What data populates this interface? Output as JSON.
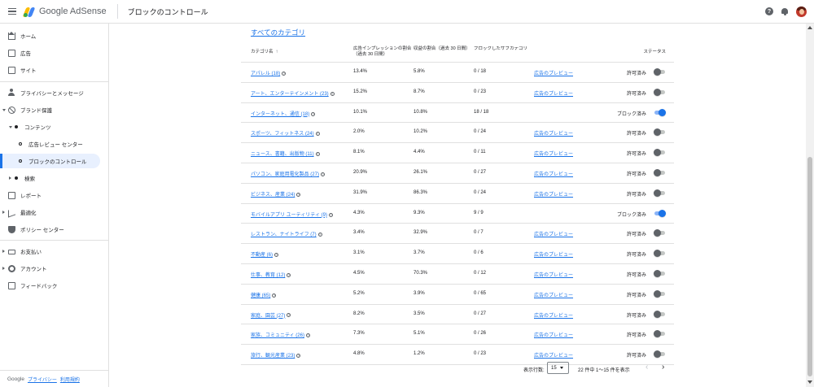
{
  "header": {
    "app_name": "Google AdSense",
    "page_title": "ブロックのコントロール"
  },
  "sidebar": {
    "items": [
      {
        "label": "ホーム"
      },
      {
        "label": "広告"
      },
      {
        "label": "サイト"
      },
      {
        "label": "プライバシーとメッセージ"
      },
      {
        "label": "ブランド保護"
      },
      {
        "label": "コンテンツ"
      },
      {
        "label": "広告レビュー センター"
      },
      {
        "label": "ブロックのコントロール"
      },
      {
        "label": "検索"
      },
      {
        "label": "レポート"
      },
      {
        "label": "最適化"
      },
      {
        "label": "ポリシー センター"
      },
      {
        "label": "お支払い"
      },
      {
        "label": "アカウント"
      },
      {
        "label": "フィードバック"
      }
    ],
    "footer": {
      "google": "Google",
      "privacy": "プライバシー",
      "terms": "利用規約"
    }
  },
  "main": {
    "all_categories": "すべてのカテゴリ",
    "columns": {
      "category": "カテゴリ名",
      "impressions": "広告インプレッションの割合\n（過去 30 日間）",
      "revenue": "収益の割合（過去 30 日間）",
      "blocked_sub": "ブロックしたサブカテゴリ",
      "status": "ステータス"
    },
    "rows": [
      {
        "name": "アパレル (18)",
        "impr": "13.4%",
        "rev": "5.8%",
        "blocked": "0 / 18",
        "preview": "広告のプレビュー",
        "status": "許可済み",
        "on": false
      },
      {
        "name": "アート、エンターテインメント (23)",
        "impr": "15.2%",
        "rev": "8.7%",
        "blocked": "0 / 23",
        "preview": "広告のプレビュー",
        "status": "許可済み",
        "on": false
      },
      {
        "name": "インターネット、通信 (18)",
        "impr": "10.1%",
        "rev": "10.8%",
        "blocked": "18 / 18",
        "preview": "",
        "status": "ブロック済み",
        "on": true
      },
      {
        "name": "スポーツ、フィットネス (24)",
        "impr": "2.0%",
        "rev": "10.2%",
        "blocked": "0 / 24",
        "preview": "広告のプレビュー",
        "status": "許可済み",
        "on": false
      },
      {
        "name": "ニュース、書籍、出版物 (11)",
        "impr": "8.1%",
        "rev": "4.4%",
        "blocked": "0 / 11",
        "preview": "広告のプレビュー",
        "status": "許可済み",
        "on": false
      },
      {
        "name": "パソコン、家庭用電化製品 (27)",
        "impr": "20.9%",
        "rev": "26.1%",
        "blocked": "0 / 27",
        "preview": "広告のプレビュー",
        "status": "許可済み",
        "on": false
      },
      {
        "name": "ビジネス、産業 (24)",
        "impr": "31.9%",
        "rev": "86.3%",
        "blocked": "0 / 24",
        "preview": "広告のプレビュー",
        "status": "許可済み",
        "on": false
      },
      {
        "name": "モバイルアプリ ユーティリティ (9)",
        "impr": "4.3%",
        "rev": "9.3%",
        "blocked": "9 / 9",
        "preview": "",
        "status": "ブロック済み",
        "on": true
      },
      {
        "name": "レストラン、ナイトライフ (7)",
        "impr": "3.4%",
        "rev": "32.9%",
        "blocked": "0 / 7",
        "preview": "広告のプレビュー",
        "status": "許可済み",
        "on": false
      },
      {
        "name": "不動産 (6)",
        "impr": "3.1%",
        "rev": "3.7%",
        "blocked": "0 / 6",
        "preview": "広告のプレビュー",
        "status": "許可済み",
        "on": false
      },
      {
        "name": "仕事、教育 (12)",
        "impr": "4.5%",
        "rev": "70.3%",
        "blocked": "0 / 12",
        "preview": "広告のプレビュー",
        "status": "許可済み",
        "on": false
      },
      {
        "name": "健康 (65)",
        "impr": "5.2%",
        "rev": "3.9%",
        "blocked": "0 / 65",
        "preview": "広告のプレビュー",
        "status": "許可済み",
        "on": false
      },
      {
        "name": "家庭、園芸 (27)",
        "impr": "8.2%",
        "rev": "3.5%",
        "blocked": "0 / 27",
        "preview": "広告のプレビュー",
        "status": "許可済み",
        "on": false
      },
      {
        "name": "家族、コミュニティ (26)",
        "impr": "7.3%",
        "rev": "5.1%",
        "blocked": "0 / 26",
        "preview": "広告のプレビュー",
        "status": "許可済み",
        "on": false
      },
      {
        "name": "旅行、観光産業 (23)",
        "impr": "4.8%",
        "rev": "1.2%",
        "blocked": "0 / 23",
        "preview": "広告のプレビュー",
        "status": "許可済み",
        "on": false
      }
    ],
    "pager": {
      "rows_label": "表示行数:",
      "rows_value": "15",
      "range": "22 件中 1～15 件を表示"
    }
  }
}
